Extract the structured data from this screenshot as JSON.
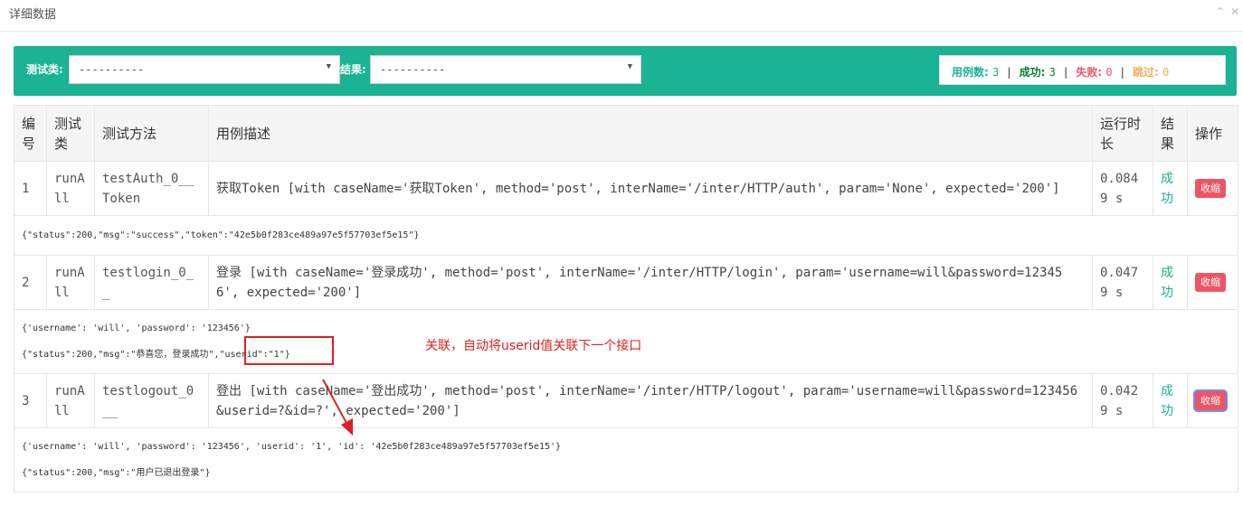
{
  "panel": {
    "title": "详细数据",
    "icons": [
      "chevron-up-icon",
      "close-icon"
    ]
  },
  "filters": {
    "class_label": "测试类:",
    "class_value": "----------",
    "result_label": "结果:",
    "result_value": "----------"
  },
  "stats": {
    "total_label": "用例数:",
    "total": "3",
    "success_label": "成功:",
    "success": "3",
    "fail_label": "失败:",
    "fail": "0",
    "skip_label": "跳过:",
    "skip": "0",
    "colors": {
      "total": "#1ab394",
      "success": "#0a7d36",
      "fail": "#ed5565",
      "skip": "#f8ac59"
    }
  },
  "table": {
    "headers": [
      "编号",
      "测试类",
      "测试方法",
      "用例描述",
      "运行时长",
      "结果",
      "操作"
    ],
    "rows": [
      {
        "id": "1",
        "class": "runAll",
        "method": "testAuth_0__Token",
        "desc": "获取Token [with caseName='获取Token', method='post', interName='/inter/HTTP/auth', param='None', expected='200']",
        "duration": "0.0849 s",
        "result": "成功",
        "action": "收缩",
        "details": [
          "{\"status\":200,\"msg\":\"success\",\"token\":\"42e5b0f283ce489a97e5f57703ef5e15\"}"
        ]
      },
      {
        "id": "2",
        "class": "runAll",
        "method": "testlogin_0__",
        "desc": "登录 [with caseName='登录成功', method='post', interName='/inter/HTTP/login', param='username=will&password=123456', expected='200']",
        "duration": "0.0479 s",
        "result": "成功",
        "action": "收缩",
        "details": [
          "{'username': 'will', 'password': '123456'}",
          "{\"status\":200,\"msg\":\"恭喜您，登录成功\",\"userid\":\"1\"}"
        ]
      },
      {
        "id": "3",
        "class": "runAll",
        "method": "testlogout_0__",
        "desc": "登出 [with caseName='登出成功', method='post', interName='/inter/HTTP/logout', param='username=will&password=123456&userid=?&id=?', expected='200']",
        "duration": "0.0429 s",
        "result": "成功",
        "action": "收缩",
        "details": [
          "{'username': 'will', 'password': '123456', 'userid': '1', 'id': '42e5b0f283ce489a97e5f57703ef5e15'}",
          "{\"status\":200,\"msg\":\"用户已退出登录\"}"
        ]
      }
    ]
  },
  "annotation": {
    "text": "关联，自动将userid值关联下一个接口",
    "color": "#e02020"
  }
}
